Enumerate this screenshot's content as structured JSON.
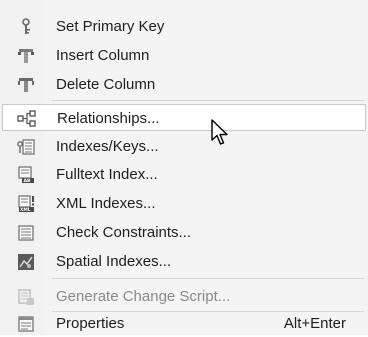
{
  "menu": {
    "items": [
      {
        "label": "Set Primary Key",
        "icon": "key-icon",
        "enabled": true
      },
      {
        "label": "Insert Column",
        "icon": "insert-column-icon",
        "enabled": true
      },
      {
        "label": "Delete Column",
        "icon": "delete-column-icon",
        "enabled": true
      },
      {
        "label": "Relationships...",
        "icon": "relationships-icon",
        "enabled": true,
        "highlighted": true
      },
      {
        "label": "Indexes/Keys...",
        "icon": "indexes-keys-icon",
        "enabled": true
      },
      {
        "label": "Fulltext Index...",
        "icon": "fulltext-index-icon",
        "enabled": true
      },
      {
        "label": "XML Indexes...",
        "icon": "xml-indexes-icon",
        "enabled": true
      },
      {
        "label": "Check Constraints...",
        "icon": "check-constraints-icon",
        "enabled": true
      },
      {
        "label": "Spatial Indexes...",
        "icon": "spatial-indexes-icon",
        "enabled": true
      },
      {
        "label": "Generate Change Script...",
        "icon": "generate-script-icon",
        "enabled": false
      },
      {
        "label": "Properties",
        "icon": "properties-icon",
        "enabled": true,
        "shortcut": "Alt+Enter"
      }
    ]
  },
  "colors": {
    "menu_background": "#f4f4f4",
    "highlight_background": "#ffffff",
    "highlight_border": "#c9c9c9",
    "text": "#1e1e1e",
    "disabled_text": "#8a8a8a",
    "separator": "#d5d5d5"
  }
}
